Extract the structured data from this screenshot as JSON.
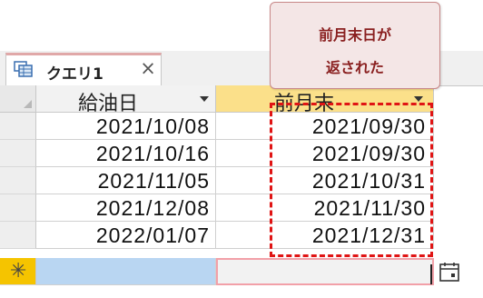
{
  "tab": {
    "label": "クエリ1",
    "close": "×"
  },
  "columns": [
    {
      "label": "給油日"
    },
    {
      "label": "前月末"
    }
  ],
  "rows": [
    {
      "fuel_date": "2021/10/08",
      "prev_month_end": "2021/09/30"
    },
    {
      "fuel_date": "2021/10/16",
      "prev_month_end": "2021/09/30"
    },
    {
      "fuel_date": "2021/11/05",
      "prev_month_end": "2021/10/31"
    },
    {
      "fuel_date": "2021/12/08",
      "prev_month_end": "2021/11/30"
    },
    {
      "fuel_date": "2022/01/07",
      "prev_month_end": "2021/12/31"
    }
  ],
  "new_row": {
    "marker": "✳"
  },
  "callout": {
    "line1": "前月末日が",
    "line2": "返された"
  },
  "colors": {
    "selected_header": "#fbe08a",
    "new_row_marker": "#f5c400",
    "highlight_dash": "#e01414",
    "callout_bg": "#f4e6e6",
    "callout_text": "#8a2020"
  },
  "icons": {
    "tab": "query-icon",
    "date_picker": "calendar-icon"
  }
}
